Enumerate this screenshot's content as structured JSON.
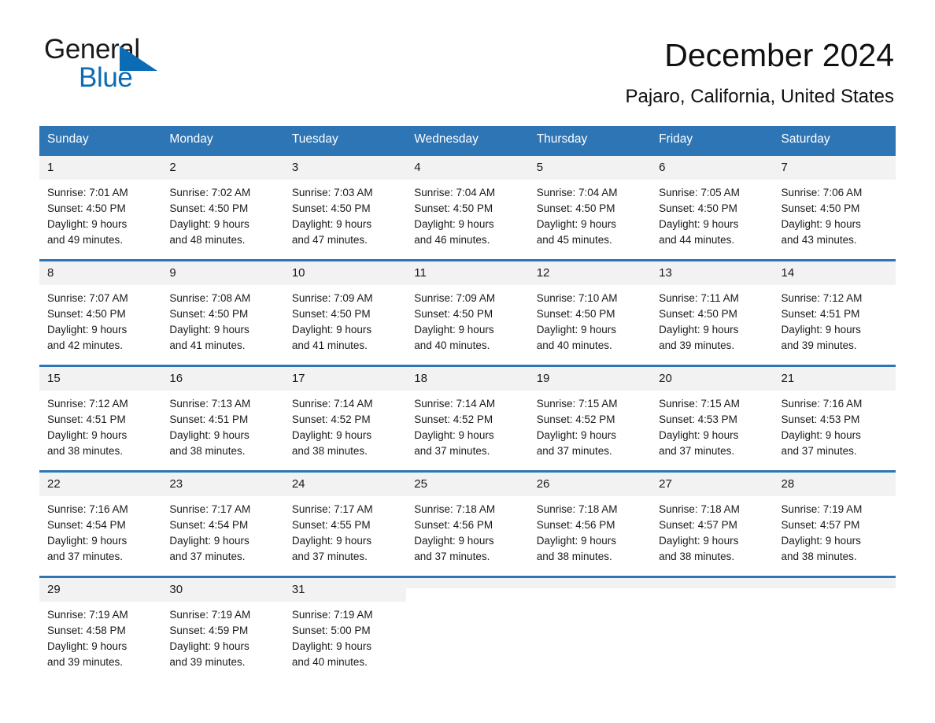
{
  "logo": {
    "text_top": "General",
    "text_bottom": "Blue",
    "triangle_color": "#0b6cb5"
  },
  "header": {
    "month_title": "December 2024",
    "location": "Pajaro, California, United States"
  },
  "theme": {
    "header_blue": "#2e75b6",
    "daynum_background": "#f2f2f2",
    "text": "#1a1a1a"
  },
  "calendar": {
    "weekday_headers": [
      "Sunday",
      "Monday",
      "Tuesday",
      "Wednesday",
      "Thursday",
      "Friday",
      "Saturday"
    ],
    "weeks": [
      [
        {
          "day": "1",
          "sunrise": "Sunrise: 7:01 AM",
          "sunset": "Sunset: 4:50 PM",
          "daylight_line1": "Daylight: 9 hours",
          "daylight_line2": "and 49 minutes."
        },
        {
          "day": "2",
          "sunrise": "Sunrise: 7:02 AM",
          "sunset": "Sunset: 4:50 PM",
          "daylight_line1": "Daylight: 9 hours",
          "daylight_line2": "and 48 minutes."
        },
        {
          "day": "3",
          "sunrise": "Sunrise: 7:03 AM",
          "sunset": "Sunset: 4:50 PM",
          "daylight_line1": "Daylight: 9 hours",
          "daylight_line2": "and 47 minutes."
        },
        {
          "day": "4",
          "sunrise": "Sunrise: 7:04 AM",
          "sunset": "Sunset: 4:50 PM",
          "daylight_line1": "Daylight: 9 hours",
          "daylight_line2": "and 46 minutes."
        },
        {
          "day": "5",
          "sunrise": "Sunrise: 7:04 AM",
          "sunset": "Sunset: 4:50 PM",
          "daylight_line1": "Daylight: 9 hours",
          "daylight_line2": "and 45 minutes."
        },
        {
          "day": "6",
          "sunrise": "Sunrise: 7:05 AM",
          "sunset": "Sunset: 4:50 PM",
          "daylight_line1": "Daylight: 9 hours",
          "daylight_line2": "and 44 minutes."
        },
        {
          "day": "7",
          "sunrise": "Sunrise: 7:06 AM",
          "sunset": "Sunset: 4:50 PM",
          "daylight_line1": "Daylight: 9 hours",
          "daylight_line2": "and 43 minutes."
        }
      ],
      [
        {
          "day": "8",
          "sunrise": "Sunrise: 7:07 AM",
          "sunset": "Sunset: 4:50 PM",
          "daylight_line1": "Daylight: 9 hours",
          "daylight_line2": "and 42 minutes."
        },
        {
          "day": "9",
          "sunrise": "Sunrise: 7:08 AM",
          "sunset": "Sunset: 4:50 PM",
          "daylight_line1": "Daylight: 9 hours",
          "daylight_line2": "and 41 minutes."
        },
        {
          "day": "10",
          "sunrise": "Sunrise: 7:09 AM",
          "sunset": "Sunset: 4:50 PM",
          "daylight_line1": "Daylight: 9 hours",
          "daylight_line2": "and 41 minutes."
        },
        {
          "day": "11",
          "sunrise": "Sunrise: 7:09 AM",
          "sunset": "Sunset: 4:50 PM",
          "daylight_line1": "Daylight: 9 hours",
          "daylight_line2": "and 40 minutes."
        },
        {
          "day": "12",
          "sunrise": "Sunrise: 7:10 AM",
          "sunset": "Sunset: 4:50 PM",
          "daylight_line1": "Daylight: 9 hours",
          "daylight_line2": "and 40 minutes."
        },
        {
          "day": "13",
          "sunrise": "Sunrise: 7:11 AM",
          "sunset": "Sunset: 4:50 PM",
          "daylight_line1": "Daylight: 9 hours",
          "daylight_line2": "and 39 minutes."
        },
        {
          "day": "14",
          "sunrise": "Sunrise: 7:12 AM",
          "sunset": "Sunset: 4:51 PM",
          "daylight_line1": "Daylight: 9 hours",
          "daylight_line2": "and 39 minutes."
        }
      ],
      [
        {
          "day": "15",
          "sunrise": "Sunrise: 7:12 AM",
          "sunset": "Sunset: 4:51 PM",
          "daylight_line1": "Daylight: 9 hours",
          "daylight_line2": "and 38 minutes."
        },
        {
          "day": "16",
          "sunrise": "Sunrise: 7:13 AM",
          "sunset": "Sunset: 4:51 PM",
          "daylight_line1": "Daylight: 9 hours",
          "daylight_line2": "and 38 minutes."
        },
        {
          "day": "17",
          "sunrise": "Sunrise: 7:14 AM",
          "sunset": "Sunset: 4:52 PM",
          "daylight_line1": "Daylight: 9 hours",
          "daylight_line2": "and 38 minutes."
        },
        {
          "day": "18",
          "sunrise": "Sunrise: 7:14 AM",
          "sunset": "Sunset: 4:52 PM",
          "daylight_line1": "Daylight: 9 hours",
          "daylight_line2": "and 37 minutes."
        },
        {
          "day": "19",
          "sunrise": "Sunrise: 7:15 AM",
          "sunset": "Sunset: 4:52 PM",
          "daylight_line1": "Daylight: 9 hours",
          "daylight_line2": "and 37 minutes."
        },
        {
          "day": "20",
          "sunrise": "Sunrise: 7:15 AM",
          "sunset": "Sunset: 4:53 PM",
          "daylight_line1": "Daylight: 9 hours",
          "daylight_line2": "and 37 minutes."
        },
        {
          "day": "21",
          "sunrise": "Sunrise: 7:16 AM",
          "sunset": "Sunset: 4:53 PM",
          "daylight_line1": "Daylight: 9 hours",
          "daylight_line2": "and 37 minutes."
        }
      ],
      [
        {
          "day": "22",
          "sunrise": "Sunrise: 7:16 AM",
          "sunset": "Sunset: 4:54 PM",
          "daylight_line1": "Daylight: 9 hours",
          "daylight_line2": "and 37 minutes."
        },
        {
          "day": "23",
          "sunrise": "Sunrise: 7:17 AM",
          "sunset": "Sunset: 4:54 PM",
          "daylight_line1": "Daylight: 9 hours",
          "daylight_line2": "and 37 minutes."
        },
        {
          "day": "24",
          "sunrise": "Sunrise: 7:17 AM",
          "sunset": "Sunset: 4:55 PM",
          "daylight_line1": "Daylight: 9 hours",
          "daylight_line2": "and 37 minutes."
        },
        {
          "day": "25",
          "sunrise": "Sunrise: 7:18 AM",
          "sunset": "Sunset: 4:56 PM",
          "daylight_line1": "Daylight: 9 hours",
          "daylight_line2": "and 37 minutes."
        },
        {
          "day": "26",
          "sunrise": "Sunrise: 7:18 AM",
          "sunset": "Sunset: 4:56 PM",
          "daylight_line1": "Daylight: 9 hours",
          "daylight_line2": "and 38 minutes."
        },
        {
          "day": "27",
          "sunrise": "Sunrise: 7:18 AM",
          "sunset": "Sunset: 4:57 PM",
          "daylight_line1": "Daylight: 9 hours",
          "daylight_line2": "and 38 minutes."
        },
        {
          "day": "28",
          "sunrise": "Sunrise: 7:19 AM",
          "sunset": "Sunset: 4:57 PM",
          "daylight_line1": "Daylight: 9 hours",
          "daylight_line2": "and 38 minutes."
        }
      ],
      [
        {
          "day": "29",
          "sunrise": "Sunrise: 7:19 AM",
          "sunset": "Sunset: 4:58 PM",
          "daylight_line1": "Daylight: 9 hours",
          "daylight_line2": "and 39 minutes."
        },
        {
          "day": "30",
          "sunrise": "Sunrise: 7:19 AM",
          "sunset": "Sunset: 4:59 PM",
          "daylight_line1": "Daylight: 9 hours",
          "daylight_line2": "and 39 minutes."
        },
        {
          "day": "31",
          "sunrise": "Sunrise: 7:19 AM",
          "sunset": "Sunset: 5:00 PM",
          "daylight_line1": "Daylight: 9 hours",
          "daylight_line2": "and 40 minutes."
        },
        {
          "day": "",
          "sunrise": "",
          "sunset": "",
          "daylight_line1": "",
          "daylight_line2": ""
        },
        {
          "day": "",
          "sunrise": "",
          "sunset": "",
          "daylight_line1": "",
          "daylight_line2": ""
        },
        {
          "day": "",
          "sunrise": "",
          "sunset": "",
          "daylight_line1": "",
          "daylight_line2": ""
        },
        {
          "day": "",
          "sunrise": "",
          "sunset": "",
          "daylight_line1": "",
          "daylight_line2": ""
        }
      ]
    ]
  }
}
